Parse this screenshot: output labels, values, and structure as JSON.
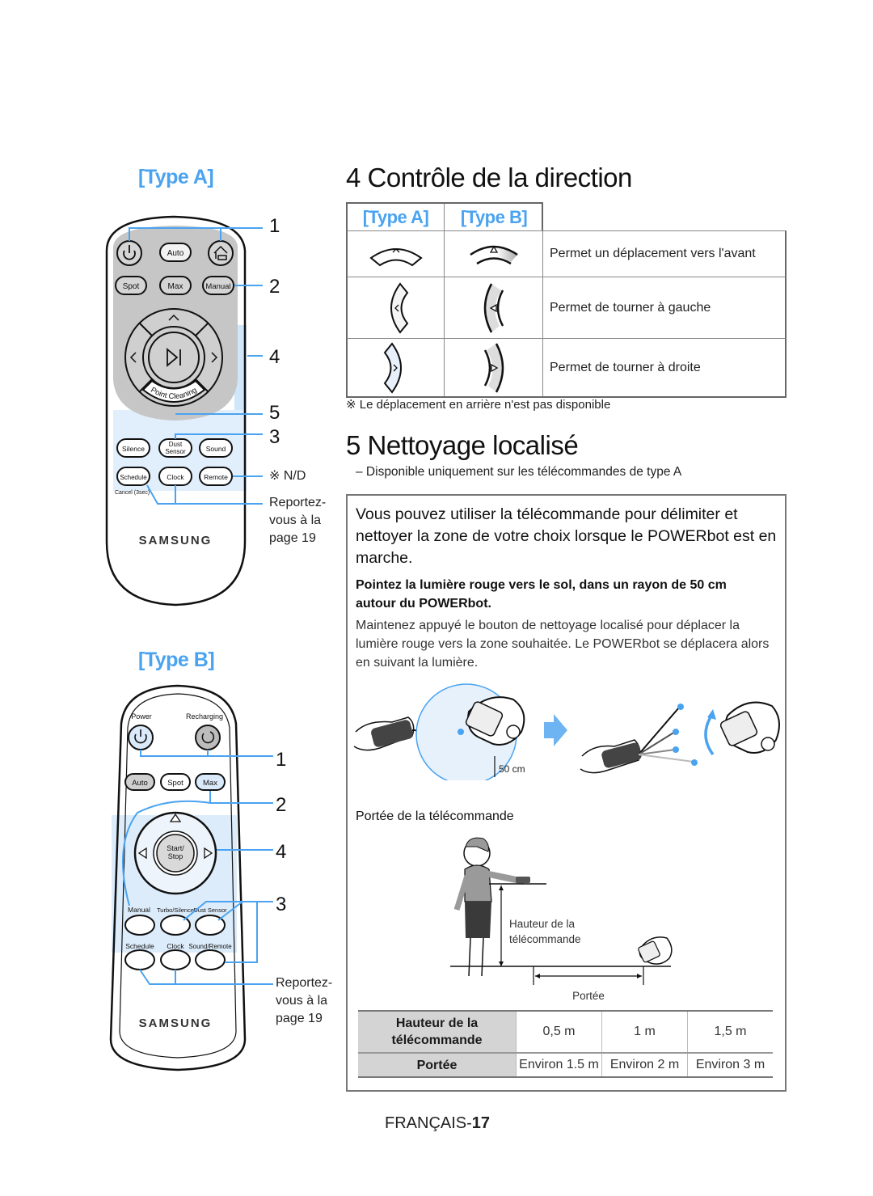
{
  "left_column": {
    "remote_a": {
      "title": "[Type A]",
      "buttons": {
        "auto": "Auto",
        "spot": "Spot",
        "max": "Max",
        "manual": "Manual",
        "point_cleaning": "Point Cleaning",
        "silence": "Silence",
        "dust_sensor_1": "Dust",
        "dust_sensor_2": "Sensor",
        "sound": "Sound",
        "schedule": "Schedule",
        "clock": "Clock",
        "remote": "Remote",
        "cancel": "Cancel (3sec)"
      },
      "brand": "SAMSUNG",
      "callouts": [
        "1",
        "2",
        "4",
        "5",
        "3"
      ],
      "nd_note": "※ N/D",
      "see_page": [
        "Reportez-",
        "vous à la",
        "page 19"
      ]
    },
    "remote_b": {
      "title": "[Type B]",
      "buttons": {
        "power": "Power",
        "recharging": "Recharging",
        "auto": "Auto",
        "spot": "Spot",
        "max": "Max",
        "start_1": "Start/",
        "start_2": "Stop",
        "manual": "Manual",
        "turbo_silence": "Turbo/Silence",
        "dust_sensor": "Dust Sensor",
        "schedule": "Schedule",
        "clock": "Clock",
        "sound_remote": "Sound/Remote"
      },
      "brand": "SAMSUNG",
      "callouts": [
        "1",
        "2",
        "4",
        "3"
      ],
      "see_page": [
        "Reportez-",
        "vous à la",
        "page 19"
      ]
    }
  },
  "section4": {
    "title": "4 Contrôle de la direction",
    "headers": [
      "[Type A]",
      "[Type B]"
    ],
    "rows": [
      {
        "icon": "up-arrow",
        "label": "Permet un déplacement vers l'avant"
      },
      {
        "icon": "left-arrow",
        "label": "Permet de tourner à gauche"
      },
      {
        "icon": "right-arrow",
        "label": "Permet de tourner à droite"
      }
    ],
    "note": "※ Le déplacement en arrière n'est pas disponible"
  },
  "section5": {
    "title": "5 Nettoyage localisé",
    "subtitle": "–  Disponible uniquement sur les télécommandes de type A",
    "lead": "Vous pouvez utiliser la télécommande pour délimiter et nettoyer la zone de votre choix lorsque le POWERbot est en marche.",
    "bold_instruction": "Pointez la lumière rouge vers le sol, dans un rayon de 50 cm autour du POWERbot.",
    "instruction": "Maintenez appuyé le bouton de nettoyage localisé pour déplacer la lumière rouge vers la zone souhaitée. Le POWERbot se déplacera alors en suivant la lumière.",
    "radius_label": "50 cm",
    "range_heading": "Portée de la télécommande",
    "diagram": {
      "height_label_1": "Hauteur de la",
      "height_label_2": "télécommande",
      "range_label": "Portée"
    },
    "range_table": {
      "row1_header": "Hauteur de la télécommande",
      "row1_values": [
        "0,5 m",
        "1 m",
        "1,5 m"
      ],
      "row2_header": "Portée",
      "row2_values": [
        "Environ 1.5 m",
        "Environ 2 m",
        "Environ 3 m"
      ]
    }
  },
  "footer": {
    "lang": "FRANÇAIS-",
    "page": "17"
  },
  "colors": {
    "accent": "#4aa3f0",
    "highlight": "#cfe6fb",
    "remote_panel": "#c8c8c8"
  }
}
